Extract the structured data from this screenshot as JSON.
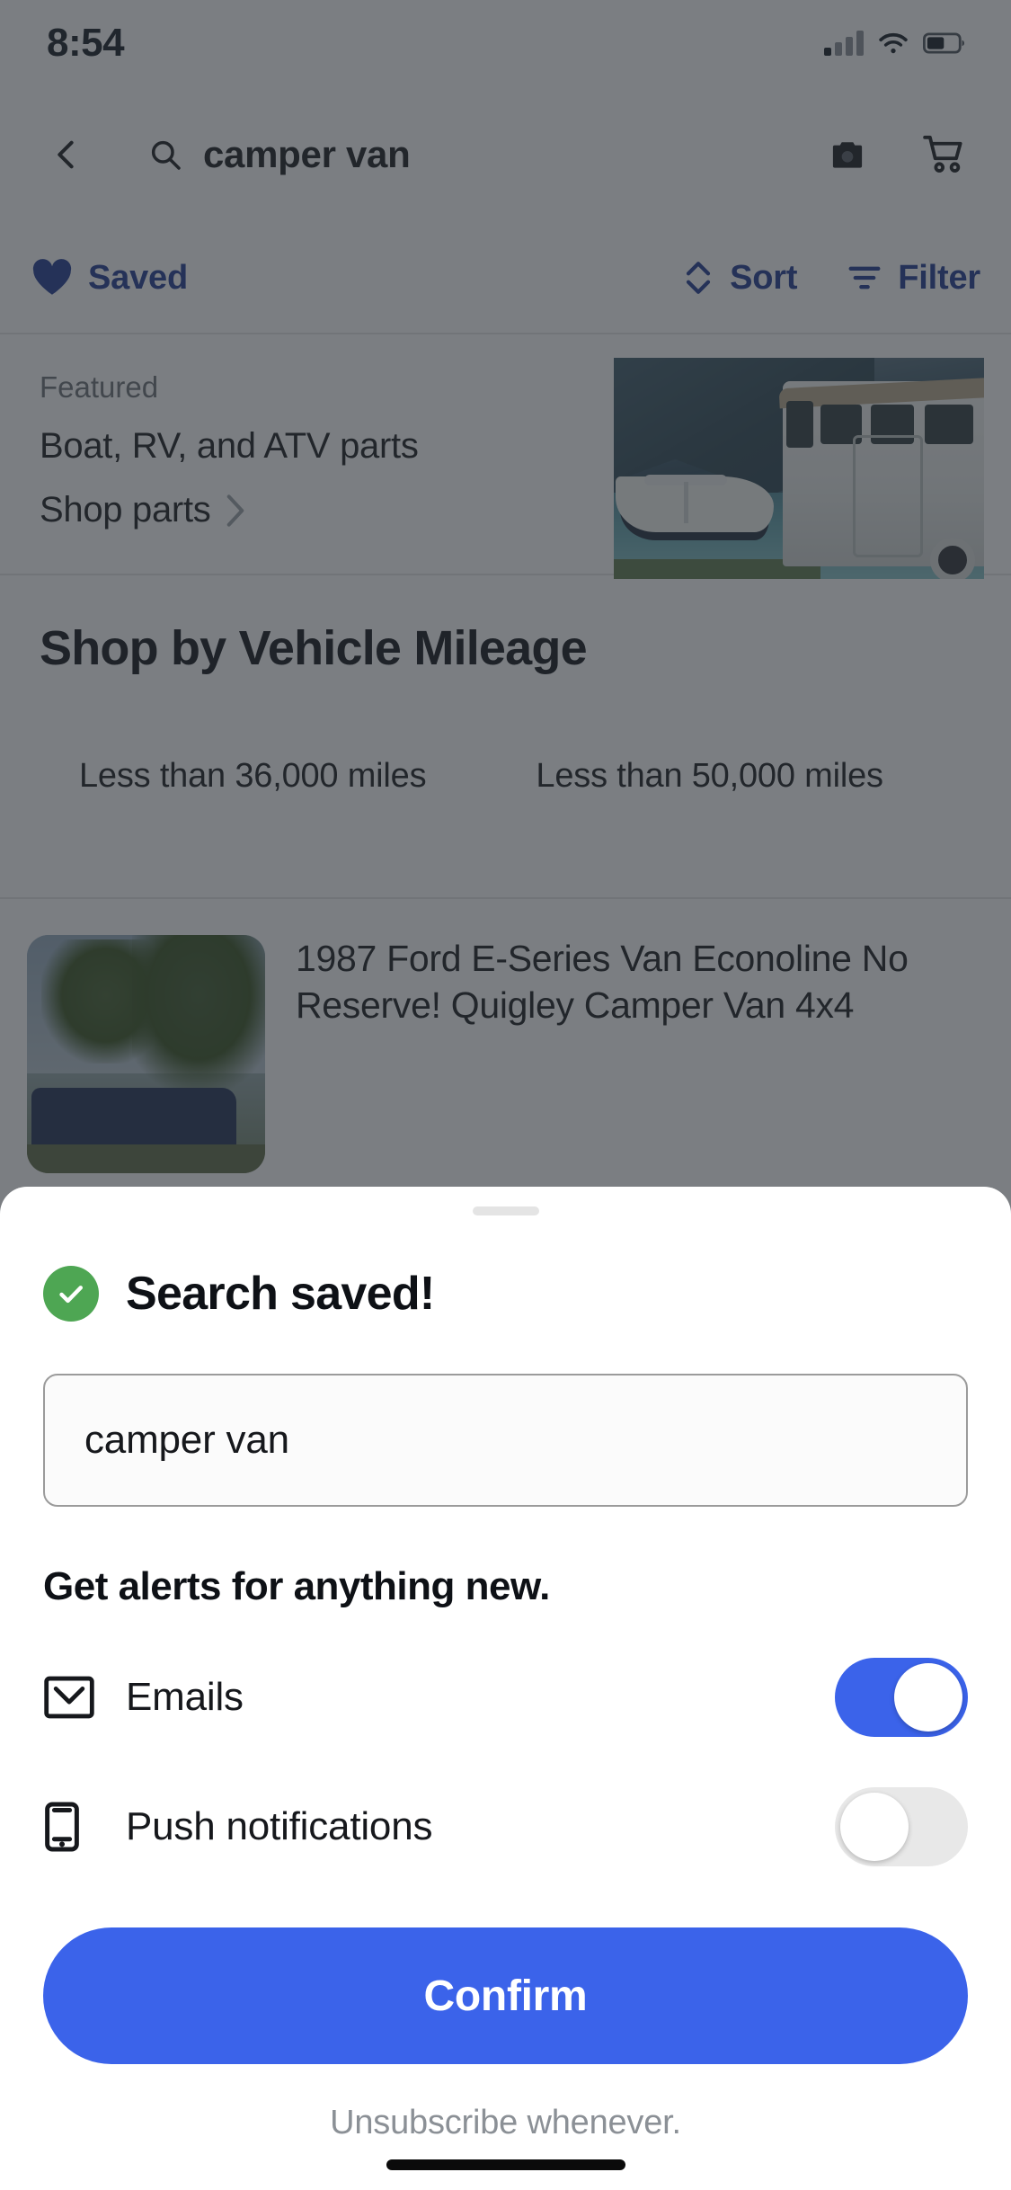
{
  "status_bar": {
    "time": "8:54",
    "signal_icon": "cellular-signal-icon",
    "wifi_icon": "wifi-icon",
    "battery_icon": "battery-icon"
  },
  "search_header": {
    "back_icon": "back-chevron-icon",
    "search_icon": "search-icon",
    "query": "camper van",
    "camera_icon": "camera-icon",
    "cart_icon": "shopping-cart-icon"
  },
  "action_bar": {
    "saved_label": "Saved",
    "saved_icon": "heart-icon",
    "sort_label": "Sort",
    "sort_icon": "sort-arrows-icon",
    "filter_label": "Filter",
    "filter_icon": "filter-icon",
    "accent_color": "#1f3990"
  },
  "featured": {
    "kicker": "Featured",
    "title": "Boat, RV, and ATV parts",
    "cta": "Shop parts",
    "cta_icon": "chevron-right-icon",
    "image_alt": "boat-and-rv-image"
  },
  "mileage": {
    "title": "Shop by Vehicle Mileage",
    "chips": [
      "Less than 36,000 miles",
      "Less than 50,000 miles"
    ]
  },
  "listing": {
    "thumbnail_alt": "camper-van-photo",
    "title": "1987 Ford E-Series Van Econoline No Reserve! Quigley Camper Van 4x4"
  },
  "bottom_sheet": {
    "handle": "drag-handle",
    "success_icon": "check-circle-icon",
    "success_color": "#4ea653",
    "title": "Search saved!",
    "search_name_value": "camper van",
    "search_name_placeholder": "camper van",
    "alerts_heading": "Get alerts for anything new.",
    "alerts": [
      {
        "label": "Emails",
        "icon": "envelope-icon",
        "enabled": "on"
      },
      {
        "label": "Push notifications",
        "icon": "mobile-phone-icon",
        "enabled": "off"
      }
    ],
    "confirm_label": "Confirm",
    "footer_note": "Unsubscribe whenever.",
    "accent_color": "#3b63ea"
  }
}
